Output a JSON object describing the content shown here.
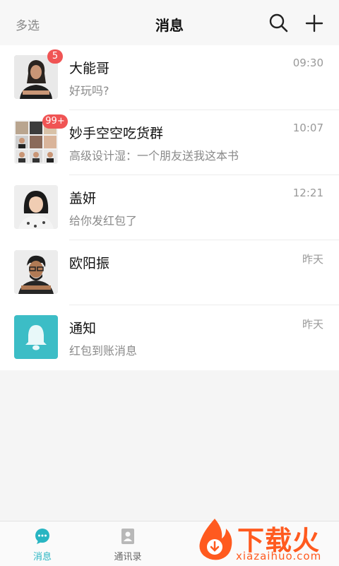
{
  "header": {
    "multi_select_label": "多选",
    "title": "消息",
    "search_icon": "search-icon",
    "add_icon": "plus-icon"
  },
  "conversations": [
    {
      "name": "大能哥",
      "preview": "好玩吗?",
      "time": "09:30",
      "badge": "5"
    },
    {
      "name": "妙手空空吃货群",
      "preview": "高级设计湿：一个朋友送我这本书",
      "time": "10:07",
      "badge": "99+"
    },
    {
      "name": "盖妍",
      "preview": "给你发红包了",
      "time": "12:21",
      "badge": ""
    },
    {
      "name": "欧阳振",
      "preview": "",
      "time": "昨天",
      "badge": ""
    },
    {
      "name": "通知",
      "preview": "红包到账消息",
      "time": "昨天",
      "badge": ""
    }
  ],
  "tabbar": {
    "tabs": [
      {
        "label": "消息",
        "active": true
      },
      {
        "label": "通讯录",
        "active": false
      }
    ]
  },
  "watermark": {
    "text": "下载火",
    "url": "xiazaihuo.com"
  },
  "colors": {
    "accent": "#28b5c2",
    "badge": "#f05454",
    "notice_bg": "#3cbdc6",
    "watermark": "#ff5a1f"
  }
}
